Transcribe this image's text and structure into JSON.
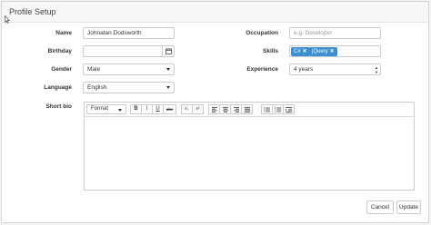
{
  "panel": {
    "title": "Profile Setup"
  },
  "form": {
    "name": {
      "label": "Name",
      "value": "Johnatan Dodsworth"
    },
    "birthday": {
      "label": "Birthday",
      "value": ""
    },
    "gender": {
      "label": "Gender",
      "value": "Male"
    },
    "language": {
      "label": "Language",
      "value": "English"
    },
    "short_bio": {
      "label": "Short bio",
      "value": ""
    },
    "occupation": {
      "label": "Occupation",
      "placeholder": "e.g. Developer"
    },
    "skills": {
      "label": "Skills",
      "tags": [
        "C#",
        "jQuery"
      ],
      "remove_glyph": "✕"
    },
    "experience": {
      "label": "Experience",
      "value": "4 years"
    }
  },
  "editor": {
    "format_label": "Format",
    "buttons": {
      "bold": "B",
      "italic": "I",
      "underline": "U",
      "strike": "abc",
      "sub": "x₂",
      "sup": "x²"
    }
  },
  "footer": {
    "cancel": "Cancel",
    "update": "Update"
  },
  "colors": {
    "tag": "#3c8ed1"
  }
}
